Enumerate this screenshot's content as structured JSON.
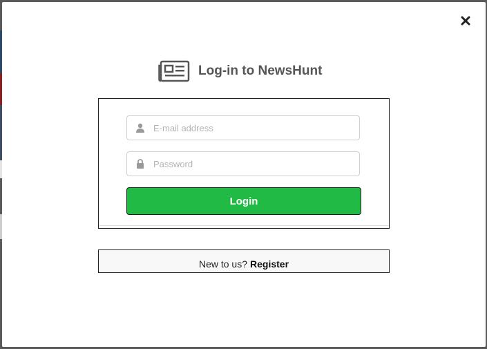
{
  "modal": {
    "close_icon": "close-icon",
    "header": {
      "icon": "newspaper-icon",
      "title": "Log-in to NewsHunt"
    },
    "form": {
      "email": {
        "icon": "user-icon",
        "value": "",
        "placeholder": "E-mail address"
      },
      "password": {
        "icon": "lock-icon",
        "value": "",
        "placeholder": "Password"
      },
      "login_label": "Login"
    },
    "register": {
      "prompt": "New to us?",
      "link_label": "Register"
    }
  },
  "colors": {
    "primary_button": "#21ba45",
    "header_text": "#555555",
    "placeholder": "#b3b3b3"
  }
}
